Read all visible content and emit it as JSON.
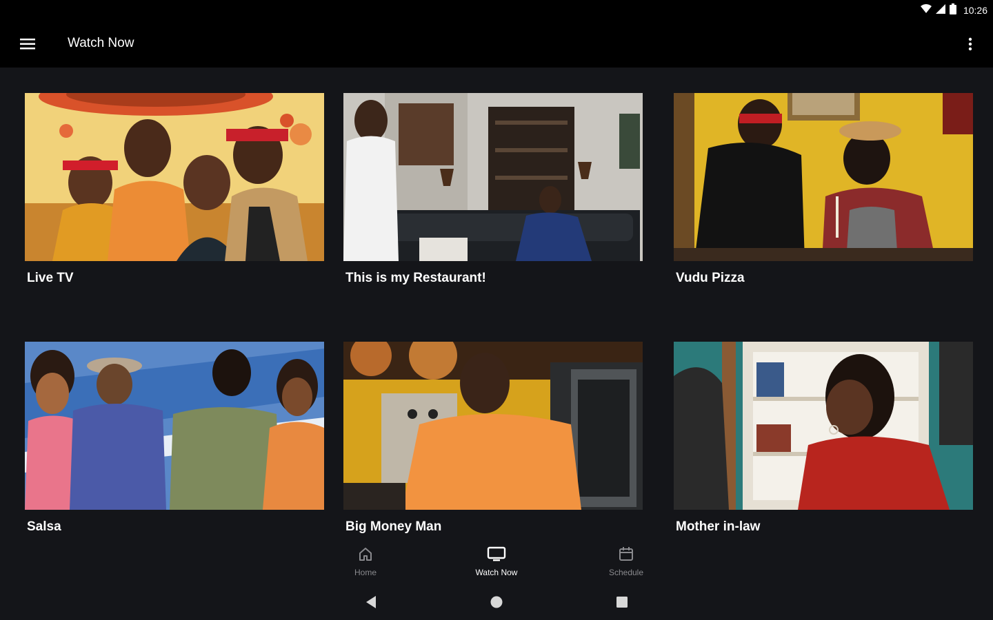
{
  "status_bar": {
    "time": "10:26",
    "icons": [
      "wifi-icon",
      "signal-icon",
      "battery-icon"
    ]
  },
  "app_bar": {
    "title": "Watch Now",
    "menu_icon": "hamburger-menu-icon",
    "more_icon": "more-vert-icon"
  },
  "cards": [
    {
      "title": "Live TV"
    },
    {
      "title": "This is my Restaurant!"
    },
    {
      "title": "Vudu Pizza"
    },
    {
      "title": "Salsa"
    },
    {
      "title": "Big Money Man"
    },
    {
      "title": "Mother in-law"
    }
  ],
  "bottom_nav": {
    "items": [
      {
        "label": "Home",
        "icon": "home-icon",
        "active": false
      },
      {
        "label": "Watch Now",
        "icon": "tv-icon",
        "active": true
      },
      {
        "label": "Schedule",
        "icon": "calendar-icon",
        "active": false
      }
    ]
  },
  "system_nav": {
    "icons": [
      "back-icon",
      "home-circle-icon",
      "recents-icon"
    ]
  },
  "colors": {
    "background": "#141519",
    "app_bar": "#000000",
    "active_nav": "#ffffff",
    "inactive_nav": "#8a8a8e"
  }
}
